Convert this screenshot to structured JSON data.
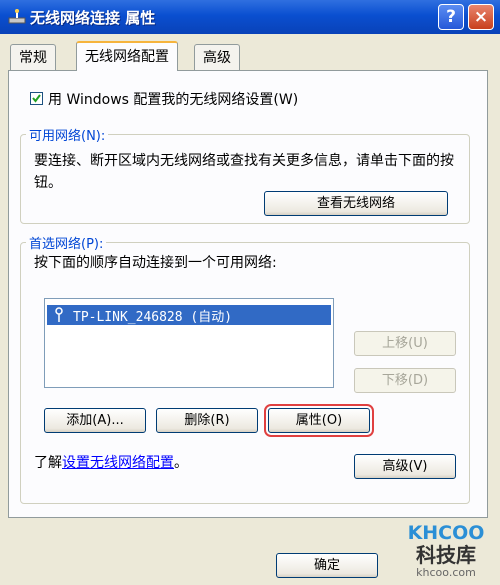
{
  "window": {
    "title": "无线网络连接 属性",
    "help_label": "?",
    "close_label": "×"
  },
  "tabs": [
    {
      "label": "常规"
    },
    {
      "label": "无线网络配置"
    },
    {
      "label": "高级"
    }
  ],
  "use_windows": {
    "label": "用 Windows 配置我的无线网络设置(W)",
    "checked": true
  },
  "available": {
    "heading": "可用网络(N):",
    "description": "要连接、断开区域内无线网络或查找有关更多信息，请单击下面的按钮。",
    "view_button": "查看无线网络"
  },
  "preferred": {
    "heading": "首选网络(P):",
    "description": "按下面的顺序自动连接到一个可用网络:",
    "networks": [
      {
        "label": "TP-LINK_246828 (自动)"
      }
    ],
    "move_up": "上移(U)",
    "move_down": "下移(D)",
    "add": "添加(A)...",
    "remove": "删除(R)",
    "properties": "属性(O)"
  },
  "learn": {
    "prefix": "了解",
    "link": "设置无线网络配置",
    "suffix": "。"
  },
  "advanced_button": "高级(V)",
  "ok_button": "确定",
  "watermark": {
    "logo": "KHCOO",
    "cn": "科技库",
    "url": "khcoo.com"
  }
}
